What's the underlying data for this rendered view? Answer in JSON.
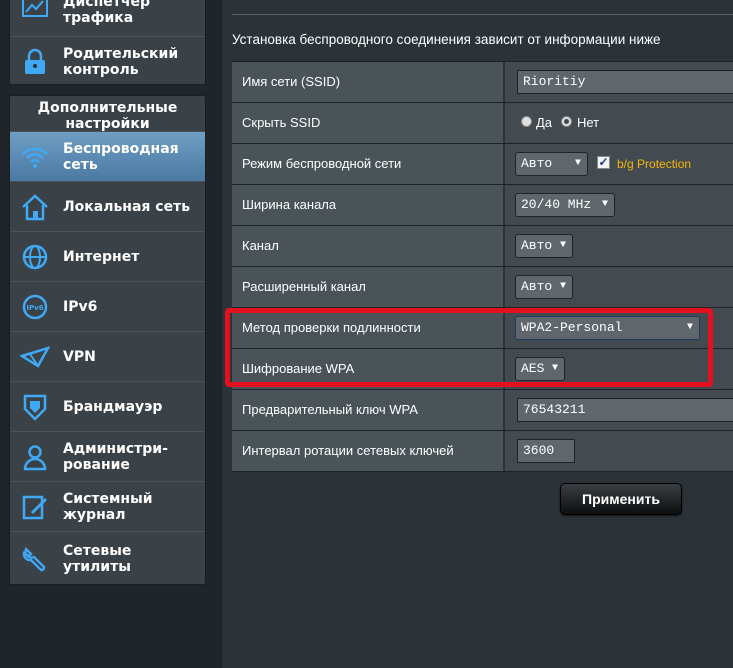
{
  "sidebar": {
    "group1": [
      {
        "label": "Диспетчер\nтрафика",
        "icon": "traffic-icon"
      },
      {
        "label": "Родительский\nконтроль",
        "icon": "lock-icon"
      }
    ],
    "group2_title": "Дополнительные\nнастройки",
    "group2": [
      {
        "label": "Беспроводная\nсеть",
        "icon": "wifi-icon",
        "active": true
      },
      {
        "label": "Локальная сеть",
        "icon": "home-icon"
      },
      {
        "label": "Интернет",
        "icon": "globe-icon"
      },
      {
        "label": "IPv6",
        "icon": "ipv6-icon"
      },
      {
        "label": "VPN",
        "icon": "vpn-icon"
      },
      {
        "label": "Брандмауэр",
        "icon": "shield-icon"
      },
      {
        "label": "Администри-\nрование",
        "icon": "admin-user-icon"
      },
      {
        "label": "Системный\nжурнал",
        "icon": "log-icon"
      },
      {
        "label": "Сетевые утилиты",
        "icon": "tools-icon"
      }
    ]
  },
  "main": {
    "info": "Установка беспроводного соединения зависит от информации ниже",
    "rows": {
      "ssid": {
        "label": "Имя сети (SSID)",
        "value": "Rioritiy"
      },
      "hide_ssid": {
        "label": "Скрыть SSID",
        "yes": "Да",
        "no": "Нет",
        "selected": "no"
      },
      "mode": {
        "label": "Режим беспроводной сети",
        "value": "Авто",
        "checkbox_label": "b/g Protection",
        "checked": true
      },
      "width": {
        "label": "Ширина канала",
        "value": "20/40 MHz"
      },
      "channel": {
        "label": "Канал",
        "value": "Авто"
      },
      "ext_channel": {
        "label": "Расширенный канал",
        "value": "Авто"
      },
      "auth": {
        "label": "Метод проверки подлинности",
        "value": "WPA2-Personal"
      },
      "encryption": {
        "label": "Шифрование WPA",
        "value": "AES"
      },
      "psk": {
        "label": "Предварительный ключ WPA",
        "value": "76543211"
      },
      "rotation": {
        "label": "Интервал ротации сетевых ключей",
        "value": "3600"
      }
    },
    "apply_label": "Применить"
  },
  "colors": {
    "highlight": "#e3101f",
    "warning_text": "#f5b50a",
    "active_item": "#5b8bb4"
  }
}
